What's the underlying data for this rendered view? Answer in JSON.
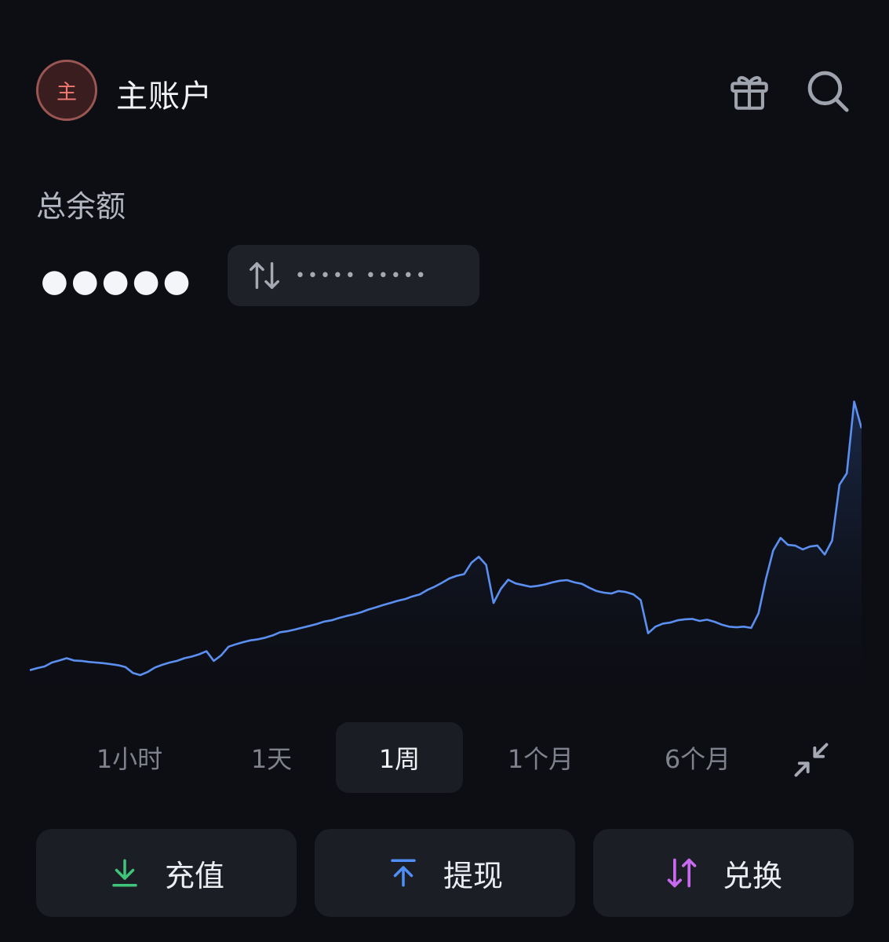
{
  "header": {
    "avatar_text": "主",
    "title": "主账户",
    "gift_icon": "gift-icon",
    "search_icon": "search-icon"
  },
  "balance": {
    "label": "总余额",
    "hidden_value": "●●●●●",
    "convert_hidden_text": "••••• •••••",
    "convert_icon": "swap-vertical-icon"
  },
  "colors": {
    "background": "#0d0e14",
    "line": "#5b8ff0",
    "deposit": "#3fc47a",
    "withdraw": "#4f8ff5",
    "exchange": "#c76af0"
  },
  "chart_data": {
    "type": "area",
    "title": "",
    "xlabel": "",
    "ylabel": "",
    "x": [
      0,
      1,
      2,
      3,
      4,
      5,
      6,
      7,
      8,
      9,
      10,
      11,
      12,
      13,
      14,
      15,
      16,
      17,
      18,
      19,
      20,
      21,
      22,
      23,
      24,
      25,
      26,
      27,
      28,
      29,
      30,
      31,
      32,
      33,
      34,
      35,
      36,
      37,
      38,
      39,
      40,
      41,
      42,
      43,
      44,
      45,
      46,
      47,
      48,
      49,
      50,
      51,
      52,
      53,
      54,
      55,
      56,
      57,
      58,
      59,
      60,
      61,
      62,
      63,
      64,
      65,
      66,
      67,
      68,
      69,
      70,
      71,
      72,
      73,
      74,
      75,
      76,
      77,
      78,
      79,
      80,
      81,
      82,
      83,
      84,
      85,
      86,
      87,
      88,
      89,
      90,
      91,
      92,
      93,
      94,
      95,
      96,
      97,
      98,
      99,
      100,
      101,
      102,
      103,
      104,
      105,
      106,
      107,
      108,
      109,
      110,
      111,
      112,
      113
    ],
    "values": [
      10.0,
      11.0,
      11.8,
      13.7,
      14.7,
      15.8,
      14.7,
      14.5,
      14.0,
      13.7,
      13.4,
      12.9,
      12.4,
      11.5,
      8.7,
      7.6,
      9.1,
      11.3,
      12.6,
      13.7,
      14.5,
      15.8,
      16.6,
      17.7,
      19.2,
      14.5,
      17.2,
      21.4,
      22.6,
      23.6,
      24.5,
      25.0,
      25.8,
      26.9,
      28.4,
      28.9,
      29.7,
      30.6,
      31.5,
      32.4,
      33.6,
      34.2,
      35.3,
      36.3,
      37.1,
      38.1,
      39.4,
      40.5,
      41.6,
      42.6,
      43.7,
      44.5,
      45.8,
      46.8,
      48.9,
      50.5,
      52.4,
      54.5,
      55.8,
      56.6,
      62.1,
      65.0,
      61.1,
      42.6,
      49.5,
      53.9,
      52.1,
      51.3,
      50.5,
      50.9,
      51.6,
      52.6,
      53.4,
      53.7,
      52.6,
      51.9,
      50.0,
      48.4,
      47.6,
      47.2,
      48.4,
      47.9,
      46.8,
      44.0,
      27.9,
      31.1,
      32.6,
      33.1,
      34.2,
      34.7,
      34.9,
      33.9,
      34.5,
      33.5,
      32.1,
      31.1,
      30.8,
      31.1,
      30.5,
      37.6,
      54.2,
      68.1,
      74.2,
      70.8,
      70.4,
      68.6,
      70.0,
      70.5,
      66.1,
      72.9,
      100.0,
      105.5,
      140.3,
      127.4
    ],
    "xlim": [
      0,
      113
    ],
    "ylim": [
      0,
      147
    ],
    "grid": false,
    "legend": "none"
  },
  "range_tabs": [
    {
      "label": "1小时",
      "active": false
    },
    {
      "label": "1天",
      "active": false
    },
    {
      "label": "1周",
      "active": true
    },
    {
      "label": "1个月",
      "active": false
    },
    {
      "label": "6个月",
      "active": false
    }
  ],
  "collapse_icon": "collapse-arrows-icon",
  "actions": [
    {
      "label": "充值",
      "icon": "download-icon"
    },
    {
      "label": "提现",
      "icon": "upload-icon"
    },
    {
      "label": "兑换",
      "icon": "swap-icon"
    }
  ]
}
